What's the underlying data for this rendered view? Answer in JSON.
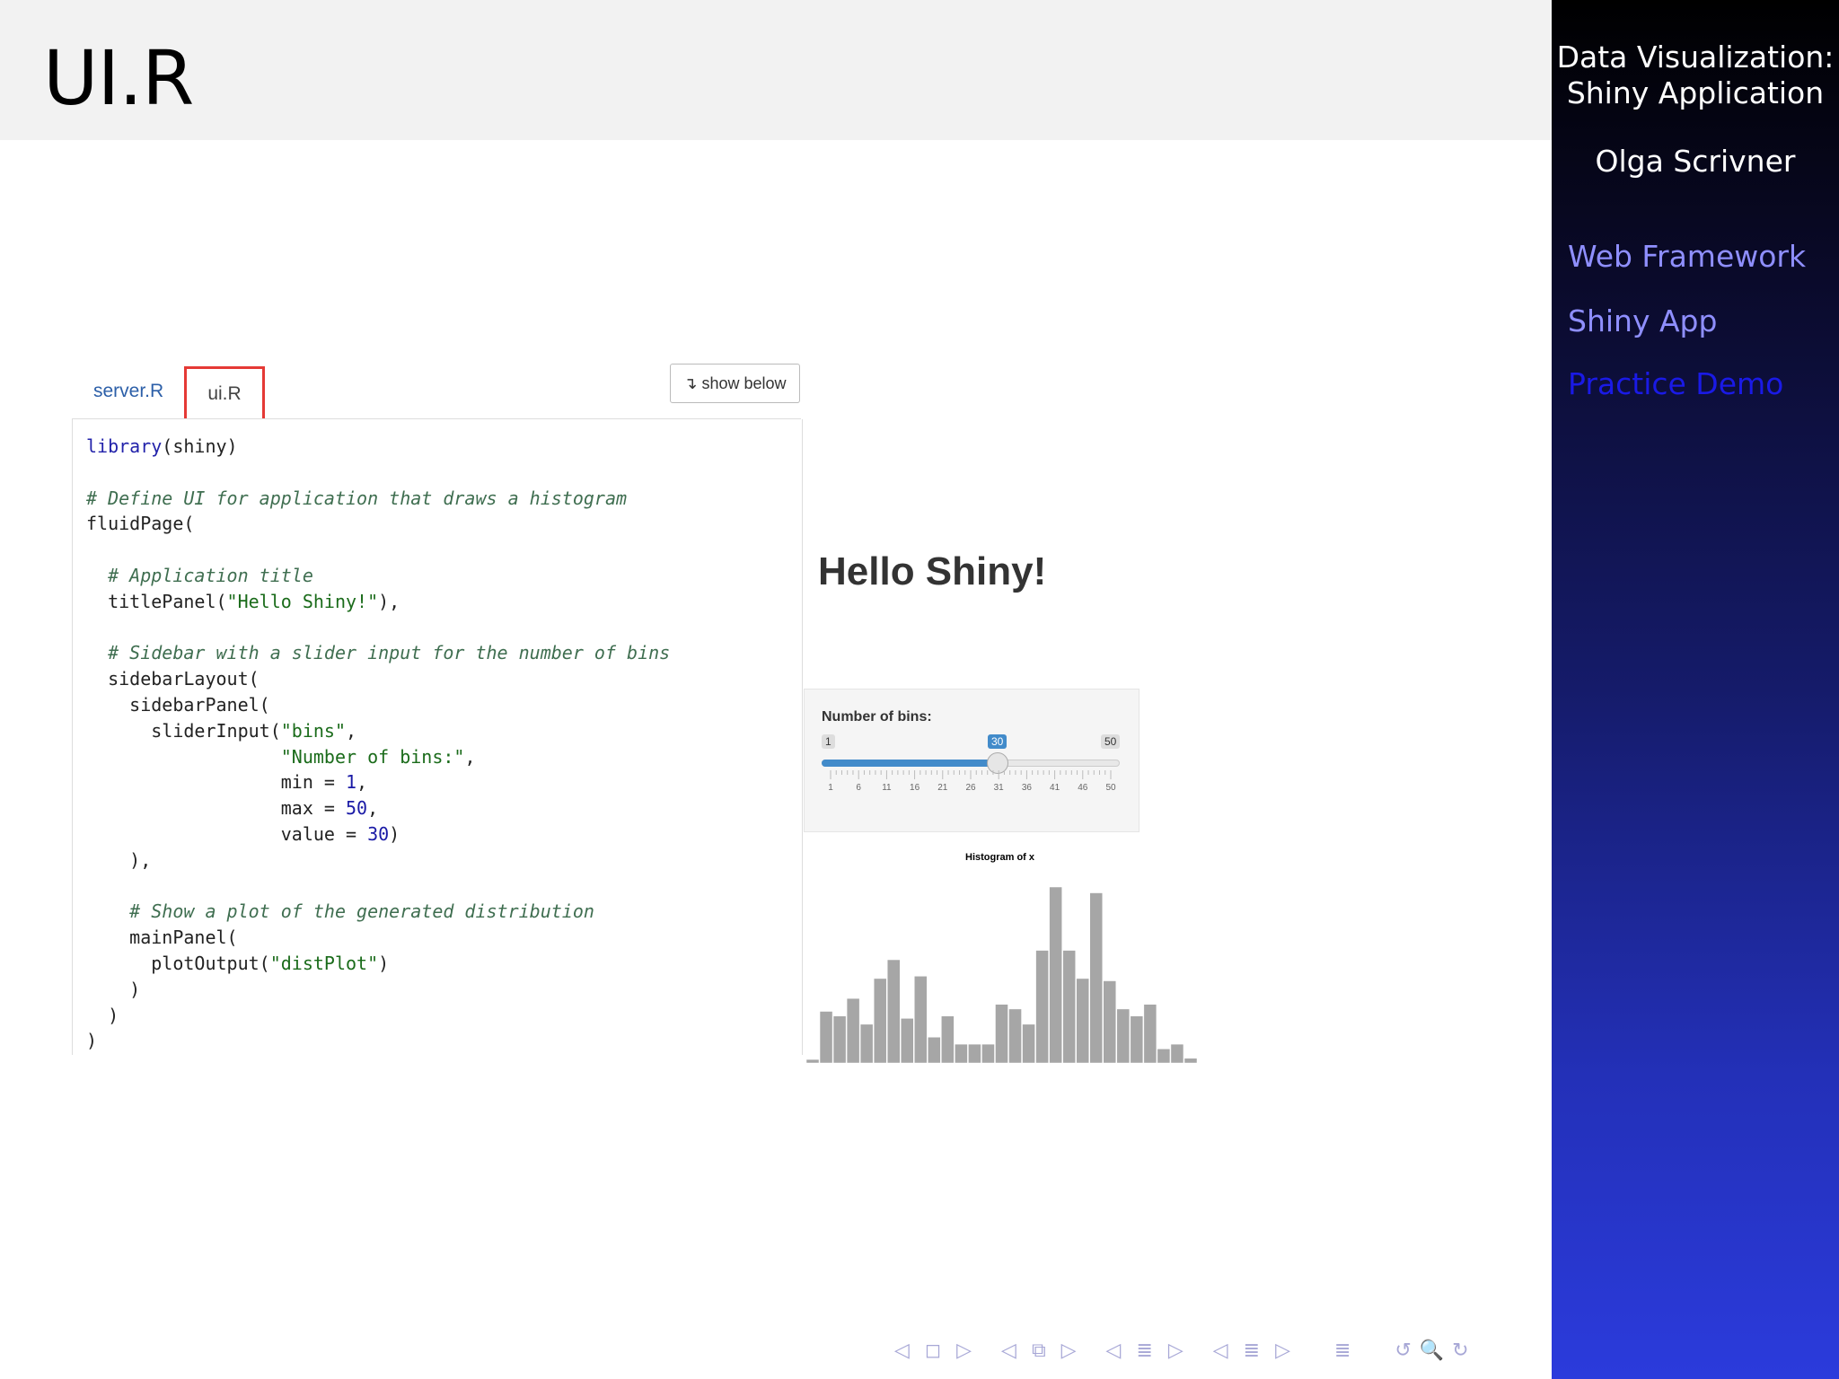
{
  "slide": {
    "title": "UI.R"
  },
  "sidebar": {
    "title_line1": "Data Visualization:",
    "title_line2": "Shiny Application",
    "author": "Olga Scrivner",
    "nav": [
      "Web Framework",
      "Shiny App",
      "Practice Demo"
    ]
  },
  "tabs": {
    "server": "server.R",
    "ui": "ui.R",
    "show_below": "↴ show below"
  },
  "code_lines": [
    [
      {
        "t": "library",
        "c": "kw"
      },
      {
        "t": "(shiny)",
        "c": ""
      }
    ],
    [],
    [
      {
        "t": "# Define UI for application that draws a histogram",
        "c": "cm"
      }
    ],
    [
      {
        "t": "fluidPage(",
        "c": ""
      }
    ],
    [],
    [
      {
        "t": "  # Application title",
        "c": "cm"
      }
    ],
    [
      {
        "t": "  titlePanel(",
        "c": ""
      },
      {
        "t": "\"Hello Shiny!\"",
        "c": "st"
      },
      {
        "t": "),",
        "c": ""
      }
    ],
    [],
    [
      {
        "t": "  # Sidebar with a slider input for the number of bins",
        "c": "cm"
      }
    ],
    [
      {
        "t": "  sidebarLayout(",
        "c": ""
      }
    ],
    [
      {
        "t": "    sidebarPanel(",
        "c": ""
      }
    ],
    [
      {
        "t": "      sliderInput(",
        "c": ""
      },
      {
        "t": "\"bins\"",
        "c": "st"
      },
      {
        "t": ",",
        "c": ""
      }
    ],
    [
      {
        "t": "                  ",
        "c": ""
      },
      {
        "t": "\"Number of bins:\"",
        "c": "st"
      },
      {
        "t": ",",
        "c": ""
      }
    ],
    [
      {
        "t": "                  min = ",
        "c": ""
      },
      {
        "t": "1",
        "c": "nm"
      },
      {
        "t": ",",
        "c": ""
      }
    ],
    [
      {
        "t": "                  max = ",
        "c": ""
      },
      {
        "t": "50",
        "c": "nm"
      },
      {
        "t": ",",
        "c": ""
      }
    ],
    [
      {
        "t": "                  value = ",
        "c": ""
      },
      {
        "t": "30",
        "c": "nm"
      },
      {
        "t": ")",
        "c": ""
      }
    ],
    [
      {
        "t": "    ),",
        "c": ""
      }
    ],
    [],
    [
      {
        "t": "    # Show a plot of the generated distribution",
        "c": "cm"
      }
    ],
    [
      {
        "t": "    mainPanel(",
        "c": ""
      }
    ],
    [
      {
        "t": "      plotOutput(",
        "c": ""
      },
      {
        "t": "\"distPlot\"",
        "c": "st"
      },
      {
        "t": ")",
        "c": ""
      }
    ],
    [
      {
        "t": "    )",
        "c": ""
      }
    ],
    [
      {
        "t": "  )",
        "c": ""
      }
    ],
    [
      {
        "t": ")",
        "c": ""
      }
    ]
  ],
  "app": {
    "title": "Hello Shiny!",
    "slider": {
      "label": "Number of bins:",
      "min": "1",
      "max": "50",
      "value": "30",
      "value_num": 30,
      "min_num": 1,
      "max_num": 50,
      "tick_labels": [
        "1",
        "6",
        "11",
        "16",
        "21",
        "26",
        "31",
        "36",
        "41",
        "46",
        "50"
      ]
    },
    "histogram": {
      "title": "Histogram of x",
      "bar_color": "#a6a6a6",
      "heights": [
        3,
        44,
        40,
        55,
        33,
        72,
        88,
        38,
        74,
        22,
        40,
        16,
        16,
        16,
        50,
        46,
        33,
        96,
        150,
        96,
        72,
        145,
        70,
        46,
        40,
        50,
        12,
        16,
        4
      ]
    }
  },
  "beamer_nav": "◁  ◻  ▷    ◁  ⧉  ▷    ◁  ≣  ▷    ◁  ≣  ▷      ≣      ↺ 🔍 ↻"
}
